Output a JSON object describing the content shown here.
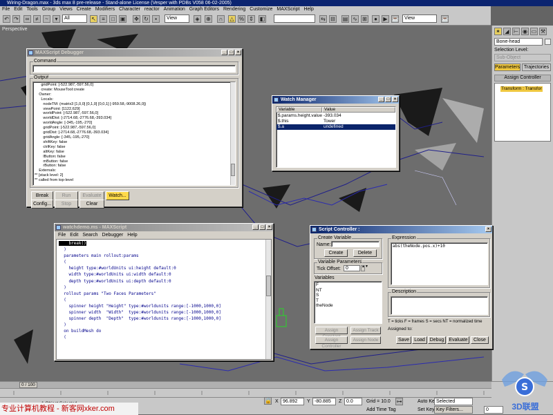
{
  "app": {
    "title": "Wiring-Dragon.max - 3ds max 8 pre-release  - Stand-alone License (Vesper with PDBs V058 06-02-2005)"
  },
  "menu": [
    "File",
    "Edit",
    "Tools",
    "Group",
    "Views",
    "Create",
    "Modifiers",
    "Character",
    "reactor",
    "Animation",
    "Graph Editors",
    "Rendering",
    "Customize",
    "MAXScript",
    "Help"
  ],
  "toolbar": {
    "selection_filter": "All",
    "ref_coord": "View",
    "ref_coord2": "View"
  },
  "viewport": {
    "label": "Perspective"
  },
  "cmd_panel": {
    "object_name": "Bone-head",
    "selection_level_label": "Selection Level:",
    "sub_object": "Sub-Object",
    "tab_parameters": "Parameters",
    "tab_trajectories": "Trajectories",
    "rollout_assign": "Assign Controller",
    "tree_item": "Transform : Transfor"
  },
  "debugger": {
    "title": "MAXScript Debugger",
    "command_label": "Command",
    "output_label": "Output",
    "output_lines": [
      "      gridPoint: [-522.987,-597.56,0]",
      "      create: MouseTool:create",
      "    Owner:",
      "      Locals:",
      "        nodeTM: (matrix3 [1,0,0] [0,1,0] [0,0,1] [-959.58,-9008.26,0])",
      "        viewPoint: [1122,629]",
      "        worldPoint: [-522.987,-597.56,0]",
      "        worldDist: [-2714.68,-2776.68,-393.034]",
      "        worldAngle: [-345,-195,-270]",
      "        gridPoint: [-522.987,-597.56,0]",
      "        gridDist: [-2714.68,-2776.68,-393.034]",
      "        gridAngle: [-345,-195,-270]",
      "        shiftKey: false",
      "        ctrlKey: false",
      "        altKey: false",
      "        lButton: false",
      "        mButton: false",
      "        rButton: false",
      "    Externals:",
      "** [stack level: 2]",
      "** called from top-level"
    ],
    "buttons": {
      "break": "Break",
      "run": "Run",
      "evaluate": "Evaluate",
      "watch": "Watch...",
      "config": "Config...",
      "stop": "Stop",
      "clear": "Clear"
    }
  },
  "watch_manager": {
    "title": "Watch Manager",
    "columns": [
      "Variable",
      "Value"
    ],
    "rows": [
      {
        "variable": "$.params.height.value",
        "value": "-393.034"
      },
      {
        "variable": "$.this",
        "value": "Tower"
      },
      {
        "variable": "$.a",
        "value": "undefined"
      }
    ]
  },
  "script_editor": {
    "title": "watchdemo.ms - MAXScript",
    "menu": [
      "File",
      "Edit",
      "Search",
      "Debugger",
      "Help"
    ],
    "lines": [
      {
        "t": "    break()",
        "hl": true
      },
      {
        "t": "  )"
      },
      {
        "t": ""
      },
      {
        "t": "  parameters main rollout:params"
      },
      {
        "t": "  ("
      },
      {
        "t": "    height type:#worldUnits ui:height default:0"
      },
      {
        "t": "    width type:#worldUnits ui:width default:0"
      },
      {
        "t": "    depth type:#worldUnits ui:depth default:0"
      },
      {
        "t": "  )"
      },
      {
        "t": "  rollout params \"Two Faces Parameters\""
      },
      {
        "t": "  ("
      },
      {
        "t": "    spinner height \"Height\" type:#worldunits range:[-1000,1000,0]"
      },
      {
        "t": "    spinner width  \"Width\"  type:#worldunits range:[-1000,1000,0]"
      },
      {
        "t": "    spinner depth  \"Depth\"  type:#worldunits range:[-1000,1000,0]"
      },
      {
        "t": ""
      },
      {
        "t": "  )"
      },
      {
        "t": ""
      },
      {
        "t": "  on buildMesh do"
      },
      {
        "t": "  ("
      }
    ]
  },
  "script_controller": {
    "title": "Script Controller :",
    "create_variable": "Create Variable",
    "name_label": "Name:",
    "create_btn": "Create",
    "delete_btn": "Delete",
    "variable_params": "Variable Parameters",
    "tick_offset_label": "Tick Offset:",
    "tick_offset_value": "0",
    "variables_label": "Variables",
    "variables": [
      "F",
      "NT",
      "S",
      "T",
      "theNode"
    ],
    "assign_constant": "Assign Constant",
    "assign_track": "Assign Track",
    "assign_controller": "Assign Controller",
    "assign_node": "Assign Node",
    "expression_label": "Expression",
    "expression": "abs(theNode.pos.x)+10",
    "description_label": "Description",
    "legend": "T = ticks      F = frames      S = secs      NT = normalized time",
    "assigned_to": "Assigned to:",
    "save": "Save",
    "load": "Load",
    "debug": "Debug",
    "evaluate": "Evaluate",
    "close": "Close"
  },
  "status": {
    "time_slider": "0 / 100",
    "x_label": "X",
    "x_value": "96.892",
    "y_label": "Y",
    "y_value": "-80.885",
    "z_label": "Z",
    "z_value": "0.0",
    "grid": "Grid = 10.0",
    "auto_key": "Auto Key",
    "selected": "Selected",
    "set_key": "Set Key",
    "key_filters": "Key Filters...",
    "add_time_tag": "Add Time Tag",
    "frame": "0",
    "objects_selected": "1 Object Selected"
  },
  "watermark": {
    "text": "专业计算机教程 - 新客网xker.com",
    "logo": "3D联盟"
  },
  "colors": {
    "title_active": "#0a246a",
    "title_grad": "#a6caf0",
    "selection": "#0a246a",
    "watch_highlight": "#ffd94a",
    "bone": "#1f1f8a"
  }
}
